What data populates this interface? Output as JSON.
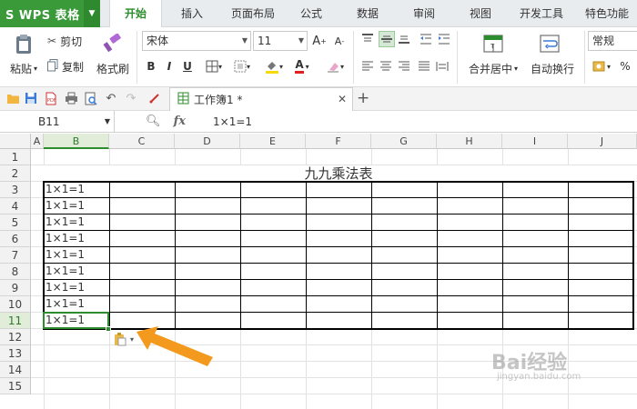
{
  "app": {
    "name": "WPS 表格",
    "logo_letter": "S"
  },
  "menu": {
    "tabs": [
      "开始",
      "插入",
      "页面布局",
      "公式",
      "数据",
      "审阅",
      "视图",
      "开发工具",
      "特色功能"
    ],
    "active_index": 0
  },
  "ribbon": {
    "paste_label": "粘贴",
    "cut_label": "剪切",
    "copy_label": "复制",
    "format_painter_label": "格式刷",
    "font_name": "宋体",
    "font_size": "11",
    "bold": "B",
    "italic": "I",
    "underline": "U",
    "merge_center_label": "合并居中",
    "wrap_text_label": "自动换行",
    "number_format": "常规",
    "percent": "%"
  },
  "quick_access": {
    "doc_tab_title": "工作簿1 *"
  },
  "formula_bar": {
    "name_box": "B11",
    "fx": "fx",
    "content": "1×1=1"
  },
  "sheet": {
    "column_headers": [
      "A",
      "B",
      "C",
      "D",
      "E",
      "F",
      "G",
      "H",
      "I",
      "J"
    ],
    "selected_column": "B",
    "row_headers": [
      "1",
      "2",
      "3",
      "4",
      "5",
      "6",
      "7",
      "8",
      "9",
      "10",
      "11",
      "12",
      "13",
      "14",
      "15"
    ],
    "selected_row": "11",
    "title": "九九乘法表",
    "b_column_values": [
      "1×1=1",
      "1×1=1",
      "1×1=1",
      "1×1=1",
      "1×1=1",
      "1×1=1",
      "1×1=1",
      "1×1=1",
      "1×1=1"
    ]
  },
  "watermark": {
    "brand": "Bai经验",
    "url": "jingyan.baidu.com"
  },
  "colors": {
    "accent_green": "#2d8c2d",
    "arrow_orange": "#f39a1e"
  }
}
